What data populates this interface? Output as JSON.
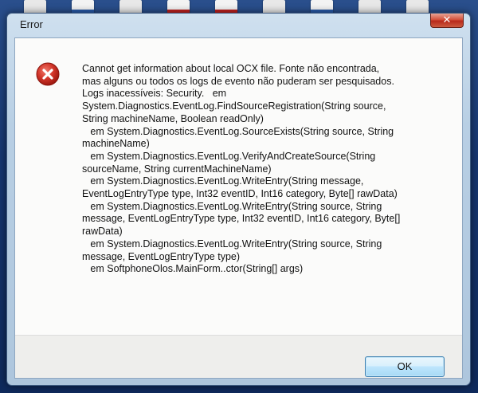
{
  "dialog": {
    "title": "Error",
    "close_glyph": "✕",
    "icon": "error-icon",
    "message": "Cannot get information about local OCX file. Fonte não encontrada,\nmas alguns ou todos os logs de evento não puderam ser pesquisados.\nLogs inacessíveis: Security.   em\nSystem.Diagnostics.EventLog.FindSourceRegistration(String source,\nString machineName, Boolean readOnly)\n   em System.Diagnostics.EventLog.SourceExists(String source, String\nmachineName)\n   em System.Diagnostics.EventLog.VerifyAndCreateSource(String\nsourceName, String currentMachineName)\n   em System.Diagnostics.EventLog.WriteEntry(String message,\nEventLogEntryType type, Int32 eventID, Int16 category, Byte[] rawData)\n   em System.Diagnostics.EventLog.WriteEntry(String source, String\nmessage, EventLogEntryType type, Int32 eventID, Int16 category, Byte[]\nrawData)\n   em System.Diagnostics.EventLog.WriteEntry(String source, String\nmessage, EventLogEntryType type)\n   em SoftphoneOlos.MainForm..ctor(String[] args)",
    "ok_label": "OK"
  },
  "colors": {
    "error_red": "#c8281d",
    "close_red": "#c43c28",
    "button_border": "#3c7fb1"
  }
}
